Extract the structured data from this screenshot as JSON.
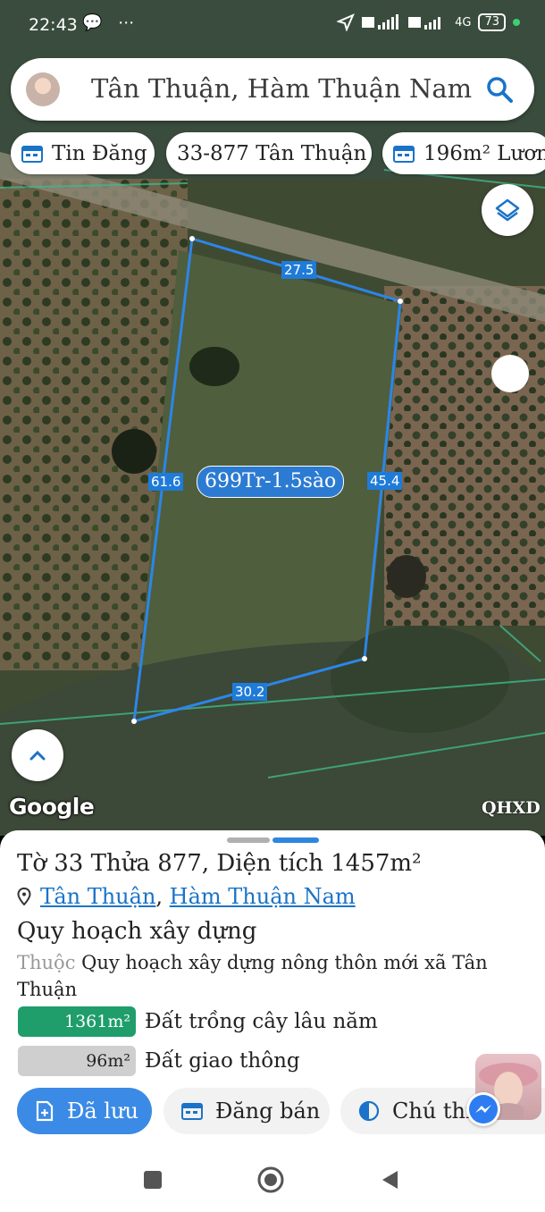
{
  "status": {
    "time": "22:43",
    "battery": "73",
    "network": "4G"
  },
  "search": {
    "query": "Tân Thuận, Hàm Thuận Nam"
  },
  "chips": [
    {
      "label": "Tin Đăng",
      "icon": "calendar-icon"
    },
    {
      "label": "33-877 Tân Thuận",
      "icon": ""
    },
    {
      "label": "196m² Lươn",
      "icon": "calendar-icon"
    }
  ],
  "map": {
    "edges": [
      "27.5",
      "61.6",
      "45.4",
      "30.2"
    ],
    "price_label": "699Tr-1.5sào",
    "watermark": "Google",
    "qhxd": "QHXD",
    "parcel_color": "#2c86e8"
  },
  "sheet": {
    "title": "Tờ 33 Thửa 877, Diện tích 1457m²",
    "location": {
      "ward": "Tân Thuận",
      "sep": ", ",
      "district": "Hàm Thuận Nam"
    },
    "section_title": "Quy hoạch xây dựng",
    "belongs_prefix": "Thuộc",
    "belongs_text": "Quy hoạch xây dựng nông thôn mới xã Tân Thuận",
    "land_uses": [
      {
        "area": "1361m²",
        "name": "Đất trồng cây lâu năm",
        "color": "#1f9d6b"
      },
      {
        "area": "96m²",
        "name": "Đất giao thông",
        "color": "#cfcfcf"
      }
    ],
    "buttons": {
      "saved": "Đã lưu",
      "post_sale": "Đăng bán",
      "note": "Chú thí"
    }
  }
}
